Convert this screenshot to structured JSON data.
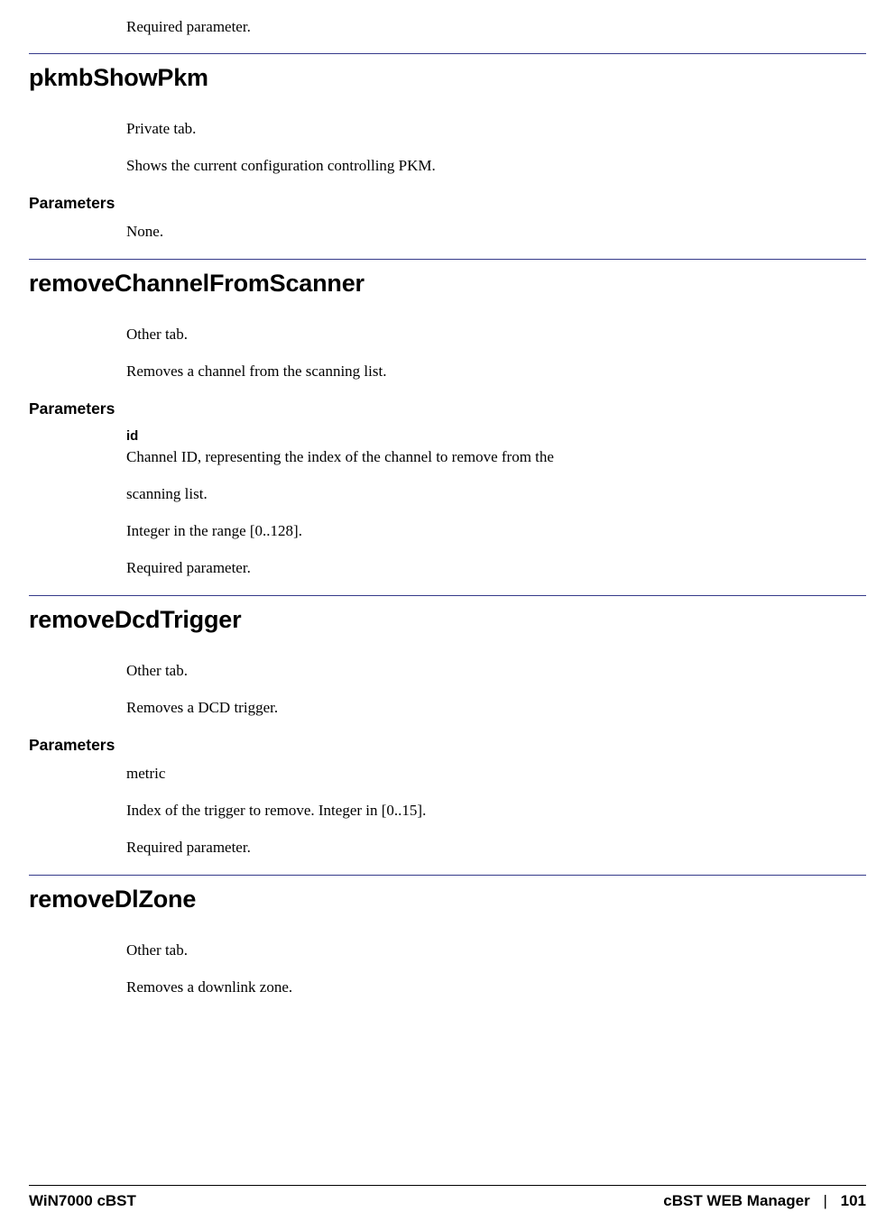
{
  "intro": {
    "required": "Required parameter."
  },
  "sections": [
    {
      "heading": "pkmbShowPkm",
      "tab": "Private tab.",
      "desc": "Shows the current configuration controlling PKM.",
      "params_heading": "Parameters",
      "params_none": "None."
    },
    {
      "heading": "removeChannelFromScanner",
      "tab": "Other tab.",
      "desc": "Removes a channel from the scanning list.",
      "params_heading": "Parameters",
      "param_id_label": "id",
      "param_id_line1": "Channel ID, representing the index of the channel to remove from the",
      "param_id_line2": "scanning list.",
      "param_id_range": "Integer in the range [0..128].",
      "param_id_required": "Required parameter."
    },
    {
      "heading": "removeDcdTrigger",
      "tab": "Other tab.",
      "desc": "Removes a DCD trigger.",
      "params_heading": "Parameters",
      "param_metric": "metric",
      "param_metric_desc": "Index of the trigger to remove. Integer in [0..15].",
      "param_metric_required": "Required parameter."
    },
    {
      "heading": "removeDlZone",
      "tab": "Other tab.",
      "desc": "Removes a downlink zone."
    }
  ],
  "footer": {
    "left": "WiN7000 cBST",
    "right_title": "cBST WEB Manager",
    "sep": "|",
    "page": "101"
  }
}
